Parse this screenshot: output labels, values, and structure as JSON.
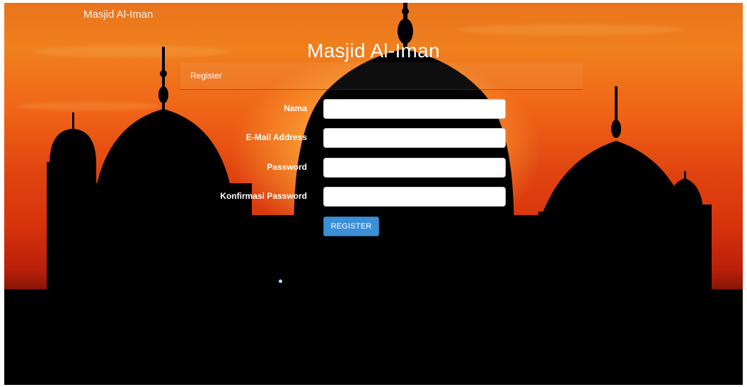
{
  "header": {
    "brand": "Masjid Al-Iman"
  },
  "hero": {
    "title": "Masjid Al-Iman"
  },
  "panel": {
    "title": "Register"
  },
  "form": {
    "fields": [
      {
        "label": "Nama",
        "value": ""
      },
      {
        "label": "E-Mail Address",
        "value": ""
      },
      {
        "label": "Password",
        "value": ""
      },
      {
        "label": "Konfirmasi Password",
        "value": ""
      }
    ],
    "submit_label": "REGISTER"
  },
  "colors": {
    "sky_top": "#e9741d",
    "sky_bottom": "#d8330c",
    "button": "#3a8fd6",
    "silhouette": "#000000"
  }
}
